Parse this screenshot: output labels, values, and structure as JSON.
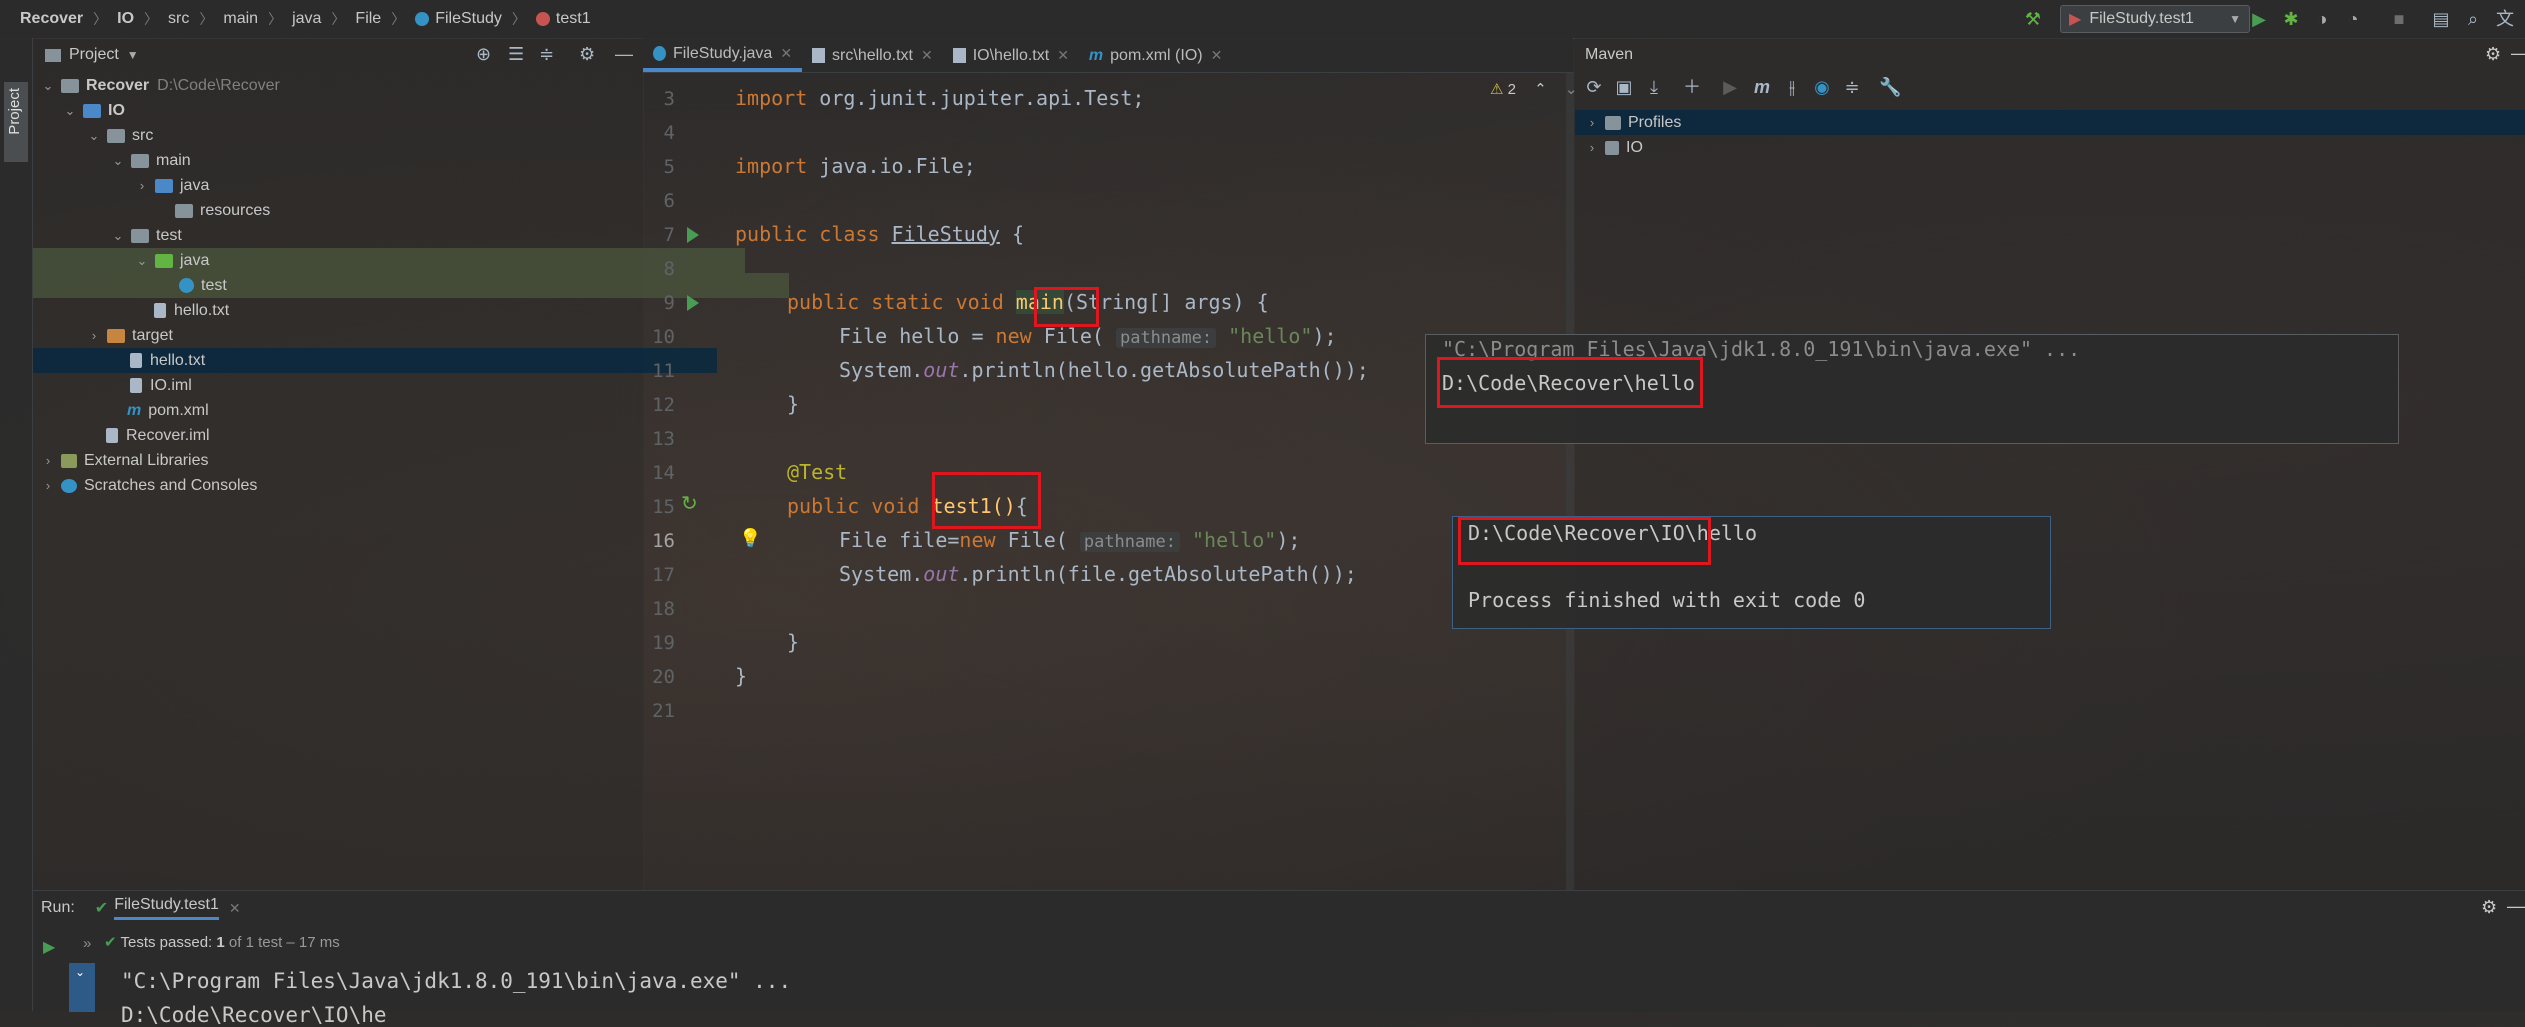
{
  "breadcrumb": [
    "Recover",
    "IO",
    "src",
    "main",
    "java",
    "File",
    "FileStudy",
    "test1"
  ],
  "run_config": "FileStudy.test1",
  "left_strip": {
    "project_tab": "Project"
  },
  "project": {
    "title": "Project",
    "tree": [
      {
        "label": "Recover",
        "extra": "D:\\Code\\Recover",
        "type": "module",
        "expanded": true
      },
      {
        "label": "IO",
        "type": "module",
        "expanded": true
      },
      {
        "label": "src",
        "type": "folder",
        "expanded": true
      },
      {
        "label": "main",
        "type": "folder",
        "expanded": true
      },
      {
        "label": "java",
        "type": "folder-blue",
        "expanded": false
      },
      {
        "label": "resources",
        "type": "folder"
      },
      {
        "label": "test",
        "type": "folder",
        "expanded": true
      },
      {
        "label": "java",
        "type": "folder-green",
        "expanded": true
      },
      {
        "label": "test",
        "type": "class"
      },
      {
        "label": "hello.txt",
        "type": "file"
      },
      {
        "label": "target",
        "type": "folder-orange",
        "expanded": false
      },
      {
        "label": "hello.txt",
        "type": "file",
        "selected": true
      },
      {
        "label": "IO.iml",
        "type": "file"
      },
      {
        "label": "pom.xml",
        "type": "maven"
      },
      {
        "label": "Recover.iml",
        "type": "file"
      },
      {
        "label": "External Libraries",
        "type": "library",
        "expanded": false
      },
      {
        "label": "Scratches and Consoles",
        "type": "scratch",
        "expanded": false
      }
    ]
  },
  "editor": {
    "tabs": [
      {
        "label": "FileStudy.java",
        "active": true
      },
      {
        "label": "src\\hello.txt"
      },
      {
        "label": "IO\\hello.txt"
      },
      {
        "label": "pom.xml (IO)"
      }
    ],
    "warnings": "2",
    "line_numbers": [
      "3",
      "4",
      "5",
      "6",
      "7",
      "8",
      "9",
      "10",
      "11",
      "12",
      "13",
      "14",
      "15",
      "16",
      "17",
      "18",
      "19",
      "20",
      "21"
    ],
    "code": {
      "l3_kw": "import",
      "l3_rest": " org.junit.jupiter.api.Test;",
      "l5_kw": "import",
      "l5_rest": " java.io.File;",
      "l7_kw": "public class",
      "l7_name": "FileStudy",
      "l7_rest": " {",
      "l9_kw": "public static void",
      "l9_name": "main",
      "l9_rest": "(String[] args) {",
      "l10_a": "File hello = ",
      "l10_kw": "new",
      "l10_b": " File(",
      "l10_hint": "pathname:",
      "l10_str": "\"hello\"",
      "l10_c": ");",
      "l11_a": "System.",
      "l11_out": "out",
      "l11_b": ".println(hello.getAbsolutePath());",
      "l12": "}",
      "l14": "@Test",
      "l15_kw": "public void",
      "l15_name": "test1()",
      "l15_rest": "{",
      "l16_a": "File file=",
      "l16_kw": "new",
      "l16_b": " File(",
      "l16_hint": "pathname:",
      "l16_str": "\"hello\"",
      "l16_c": ");",
      "l17_a": "System.",
      "l17_out": "out",
      "l17_b": ".println(file.getAbsolutePath());",
      "l19": "}",
      "l20": "}"
    }
  },
  "popup_main": {
    "line1": "\"C:\\Program Files\\Java\\jdk1.8.0_191\\bin\\java.exe\" ...",
    "line2": "D:\\Code\\Recover\\hello"
  },
  "popup_test": {
    "line1": "D:\\Code\\Recover\\IO\\hello",
    "line2": "Process finished with exit code 0"
  },
  "maven": {
    "title": "Maven",
    "items": [
      {
        "label": "Profiles",
        "selected": true
      },
      {
        "label": "IO"
      }
    ]
  },
  "run": {
    "label": "Run:",
    "tab": "FileStudy.test1",
    "status": "Tests passed:",
    "count": "1",
    "detail": "of 1 test – 17 ms",
    "console_line1": "\"C:\\Program Files\\Java\\jdk1.8.0_191\\bin\\java.exe\" ...",
    "console_line2": "D:\\Code\\Recover\\IO\\he"
  },
  "colors": {
    "accent": "#4a88c7",
    "selection": "#0d293e",
    "highlight_box": "#e0161e",
    "run_green": "#499c54"
  }
}
